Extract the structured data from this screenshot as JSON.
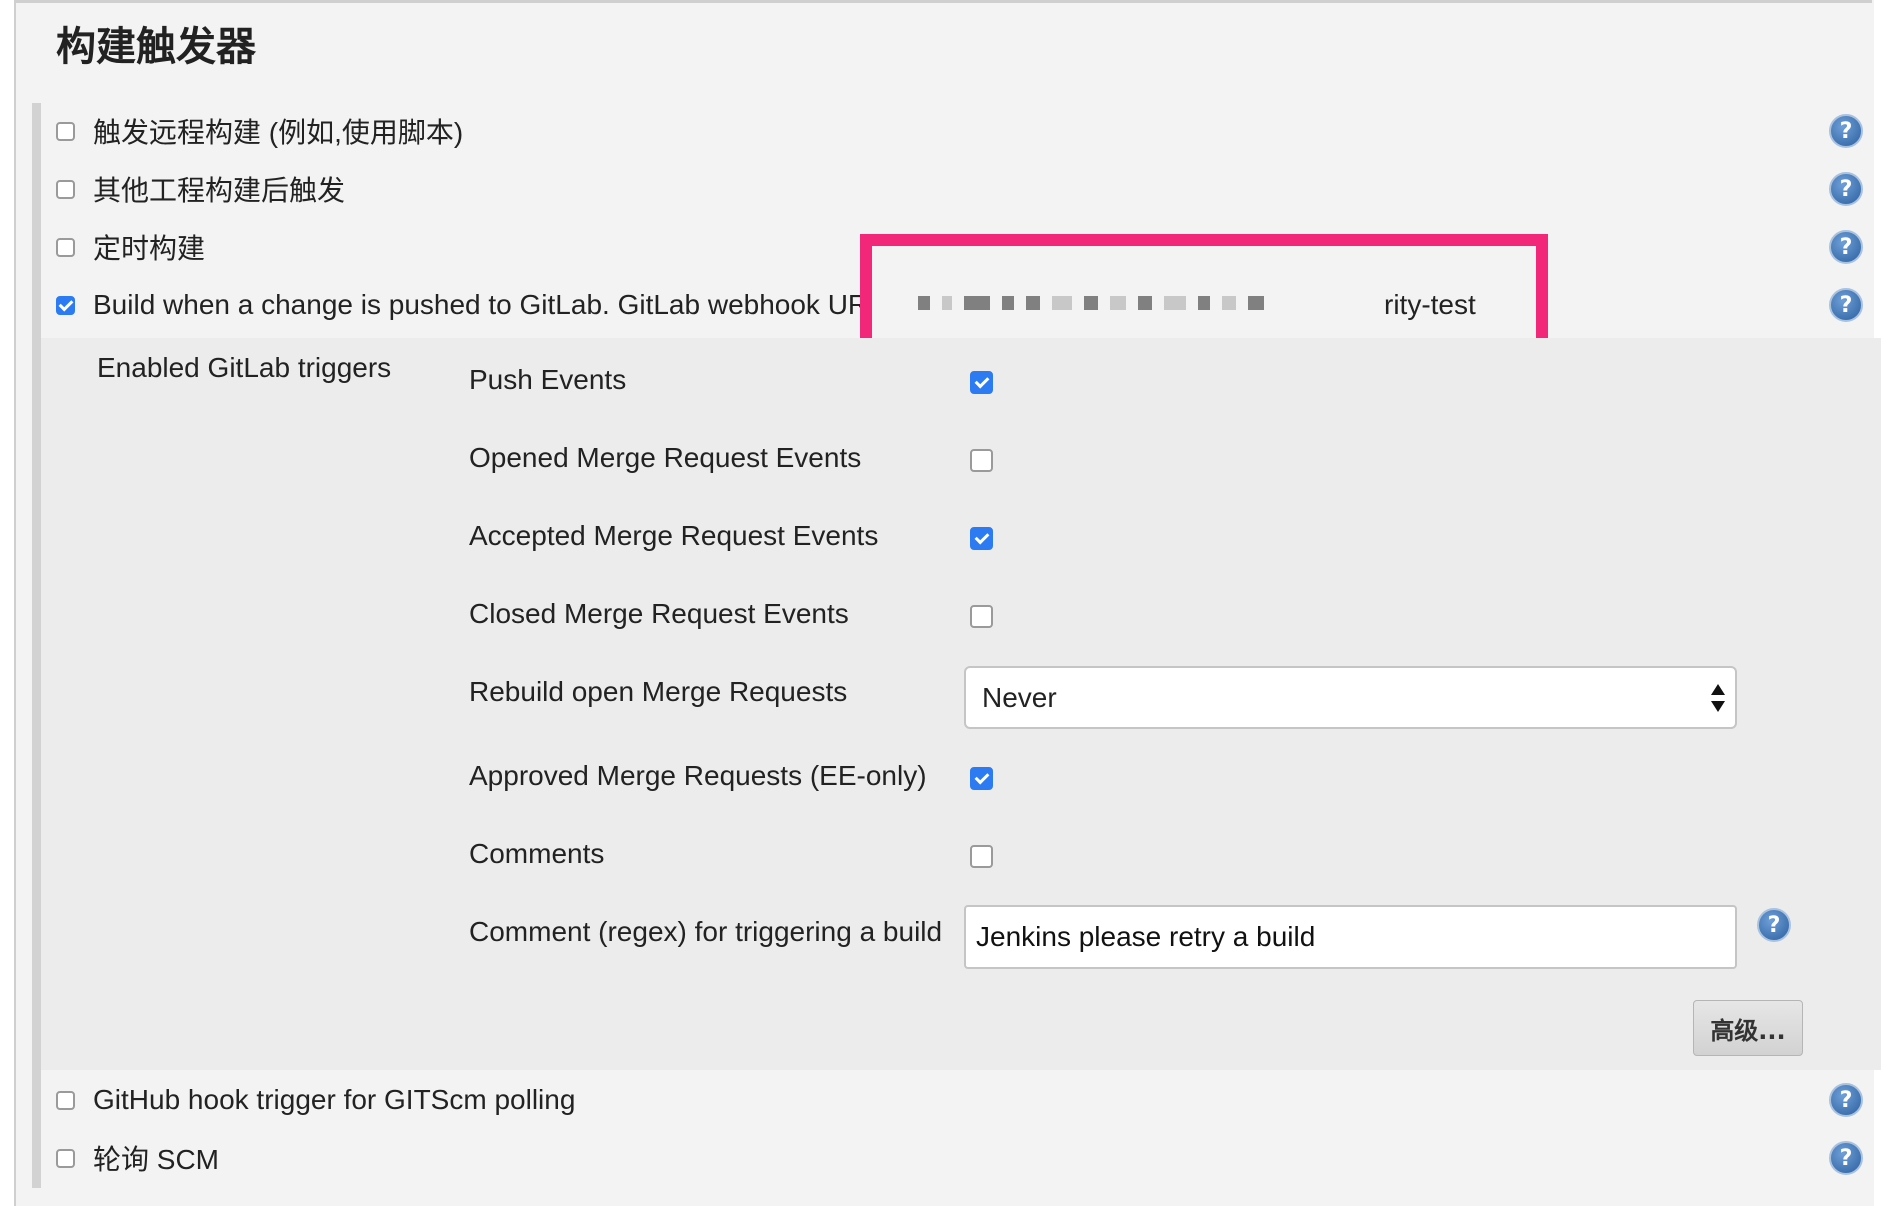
{
  "section": {
    "title": "构建触发器"
  },
  "triggers": [
    {
      "label": "触发远程构建 (例如,使用脚本)",
      "checked": false
    },
    {
      "label": "其他工程构建后触发",
      "checked": false
    },
    {
      "label": "定时构建",
      "checked": false
    },
    {
      "label_prefix": "Build when a change is pushed to GitLab. GitLab webhook UR",
      "label_suffix": "rity-test",
      "url_redacted": true,
      "checked": true
    },
    {
      "label": "GitHub hook trigger for GITScm polling",
      "checked": false
    },
    {
      "label": "轮询 SCM",
      "checked": false
    }
  ],
  "gitlab": {
    "heading": "Enabled GitLab triggers",
    "options": [
      {
        "label": "Push Events",
        "checked": true
      },
      {
        "label": "Opened Merge Request Events",
        "checked": false
      },
      {
        "label": "Accepted Merge Request Events",
        "checked": true
      },
      {
        "label": "Closed Merge Request Events",
        "checked": false
      },
      {
        "label": "Rebuild open Merge Requests",
        "value": "Never"
      },
      {
        "label": "Approved Merge Requests (EE-only)",
        "checked": true
      },
      {
        "label": "Comments",
        "checked": false
      },
      {
        "label": "Comment (regex) for triggering a build",
        "value": "Jenkins please retry a build"
      }
    ],
    "advanced_label": "高级..."
  },
  "help_icon_glyph": "?",
  "colors": {
    "accent": "#2d7bf2",
    "highlight": "#f2277a",
    "help": "#2b5f9e"
  }
}
